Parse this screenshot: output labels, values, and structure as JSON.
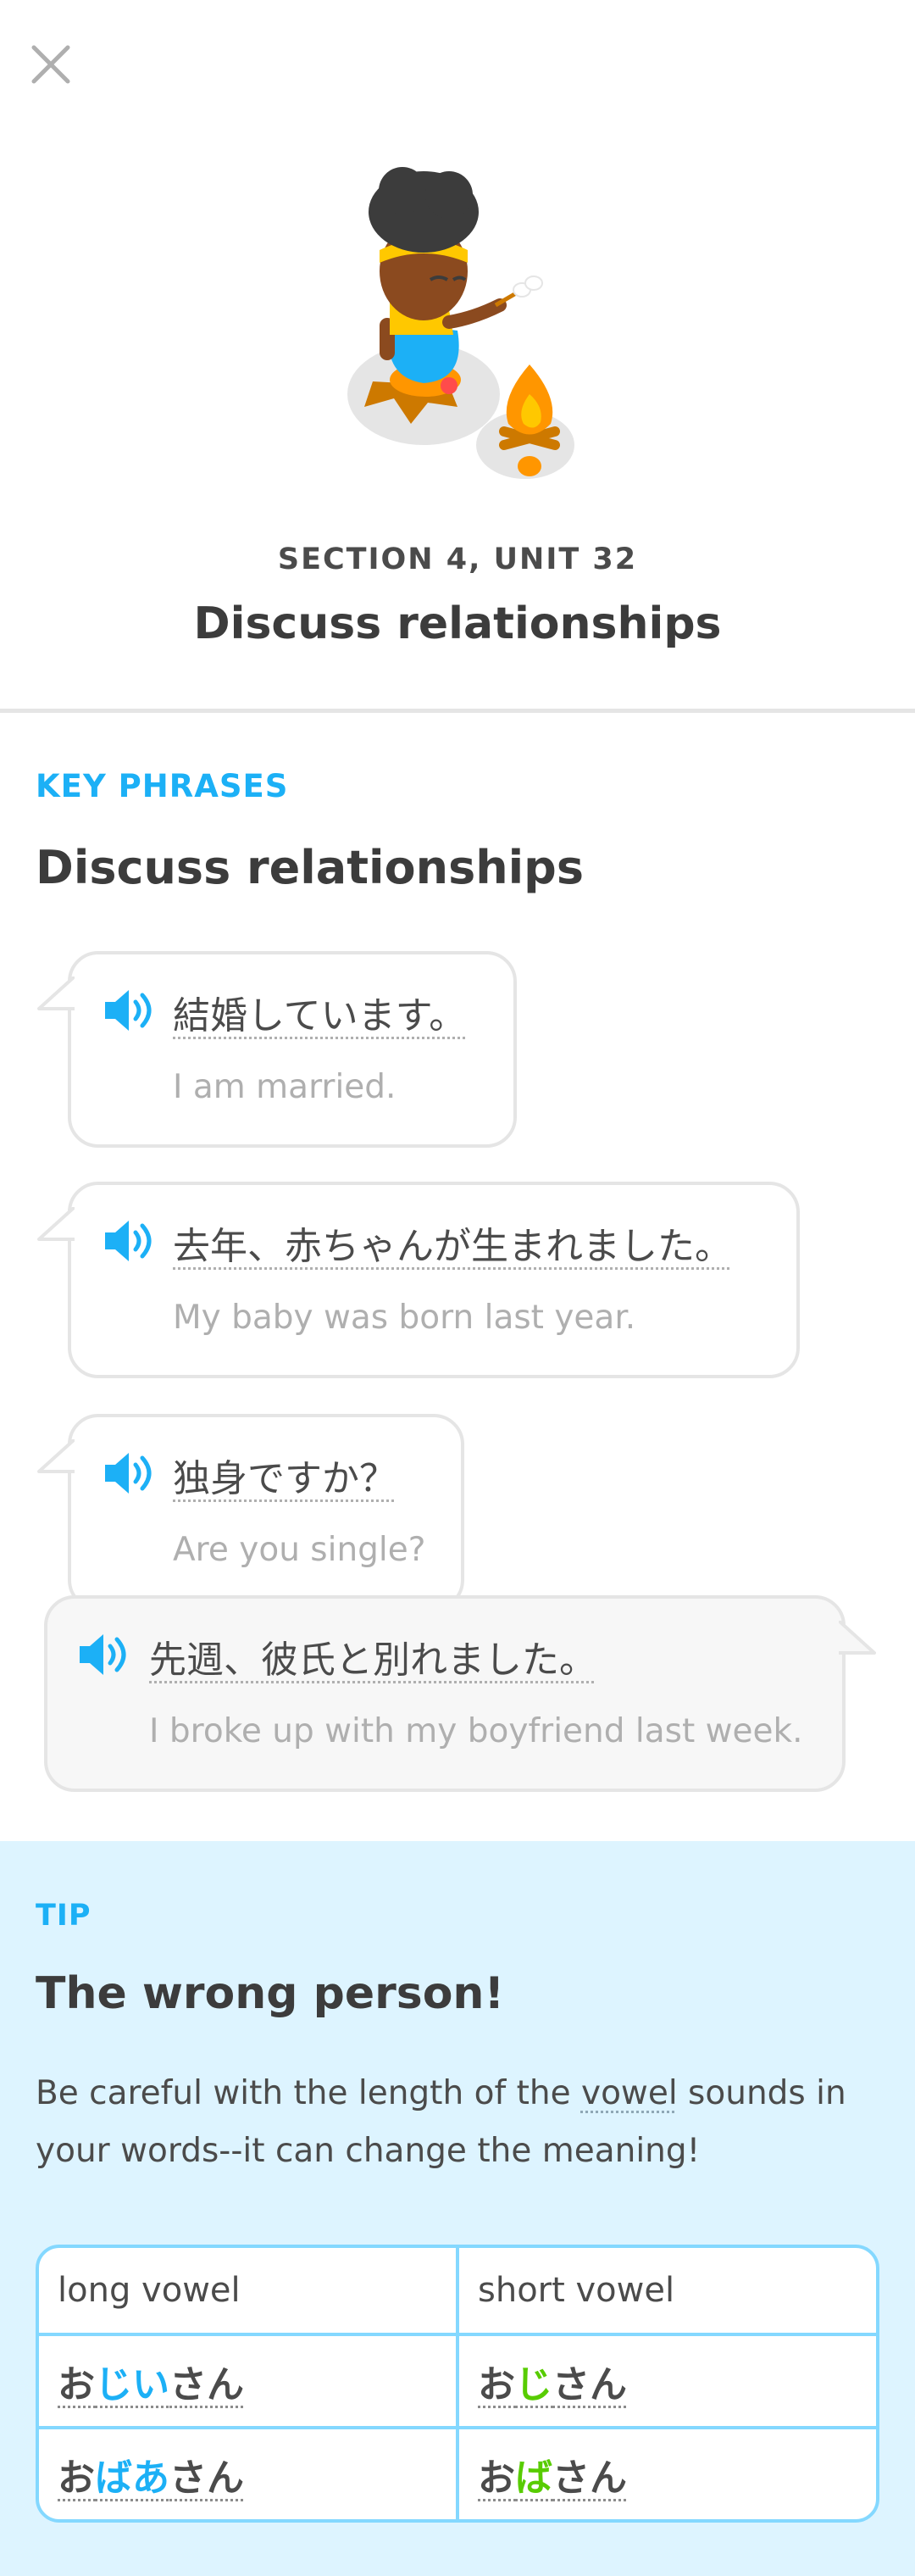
{
  "header": {
    "close_icon": "close-icon",
    "section_label": "SECTION 4, UNIT 32",
    "unit_title": "Discuss relationships"
  },
  "key_phrases": {
    "label": "KEY PHRASES",
    "heading": "Discuss relationships",
    "phrases": [
      {
        "jp": "結婚しています。",
        "en": "I am married."
      },
      {
        "jp": "去年、赤ちゃんが生まれました。",
        "en": "My baby was born last year."
      },
      {
        "jp": "独身ですか？",
        "en": "Are you single?"
      },
      {
        "jp": "先週、彼氏と別れました。",
        "en": "I broke up with my boyfriend last week."
      }
    ]
  },
  "tip": {
    "label": "TIP",
    "title": "The wrong person!",
    "body_pre": "Be careful with the length of the ",
    "body_keyword": "vowel",
    "body_post": " sounds in your words--it can change the meaning!",
    "table": {
      "headers": [
        "long vowel",
        "short vowel"
      ],
      "rows": [
        {
          "long": {
            "pre": "お",
            "hl": "じい",
            "post": "さん"
          },
          "short": {
            "pre": "お",
            "hl": "じ",
            "post": "さん"
          }
        },
        {
          "long": {
            "pre": "お",
            "hl": "ばあ",
            "post": "さん"
          },
          "short": {
            "pre": "お",
            "hl": "ば",
            "post": "さん"
          }
        }
      ]
    }
  },
  "colors": {
    "accent_blue": "#1cb0f6",
    "accent_green": "#58cc02",
    "tip_background": "#ddf4ff"
  }
}
